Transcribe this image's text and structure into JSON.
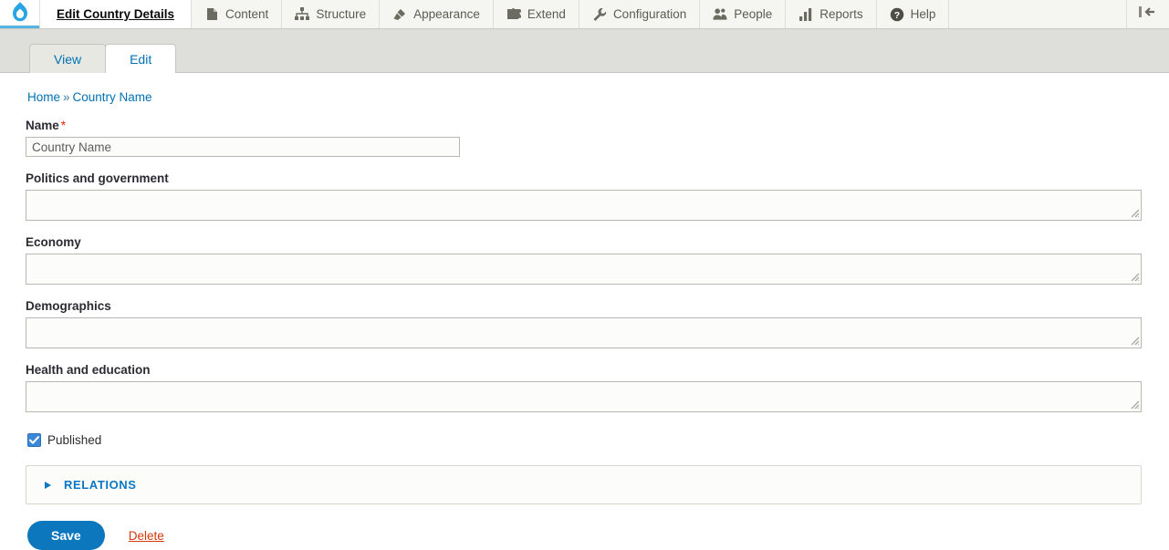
{
  "toolbar": {
    "logo_icon": "drupal-drop-icon",
    "items": [
      {
        "label": "Edit Country Details",
        "icon": "none",
        "active": true
      },
      {
        "label": "Content",
        "icon": "document-icon",
        "active": false
      },
      {
        "label": "Structure",
        "icon": "sitemap-icon",
        "active": false
      },
      {
        "label": "Appearance",
        "icon": "paintbrush-icon",
        "active": false
      },
      {
        "label": "Extend",
        "icon": "puzzle-piece-icon",
        "active": false
      },
      {
        "label": "Configuration",
        "icon": "wrench-icon",
        "active": false
      },
      {
        "label": "People",
        "icon": "people-icon",
        "active": false
      },
      {
        "label": "Reports",
        "icon": "bar-chart-icon",
        "active": false
      },
      {
        "label": "Help",
        "icon": "question-mark-icon",
        "active": false
      }
    ],
    "toggle_icon": "collapse-left-icon"
  },
  "local_tasks": [
    {
      "label": "View",
      "active": false
    },
    {
      "label": "Edit",
      "active": true
    }
  ],
  "breadcrumb": {
    "home": "Home",
    "separator": "»",
    "current": "Country Name"
  },
  "form": {
    "name": {
      "label": "Name",
      "required_marker": "*",
      "value": "Country Name",
      "placeholder": "Country Name"
    },
    "textareas": [
      {
        "label": "Politics and government",
        "value": ""
      },
      {
        "label": "Economy",
        "value": ""
      },
      {
        "label": "Demographics",
        "value": ""
      },
      {
        "label": "Health and education",
        "value": ""
      }
    ],
    "published": {
      "label": "Published",
      "checked": true
    },
    "relations": {
      "title": "RELATIONS",
      "expanded": false
    },
    "actions": {
      "save_label": "Save",
      "delete_label": "Delete"
    }
  },
  "colors": {
    "accent_blue": "#0071b3",
    "save_blue": "#0d77bd",
    "required_red": "#e32700",
    "delete_red": "#d3380a",
    "relations_blue": "#0b78c4",
    "checkbox_blue": "#3b88d8",
    "toolbar_bg": "#f5f5f2",
    "tabs_band_bg": "#dededa",
    "field_bg": "#fcfcfa"
  }
}
